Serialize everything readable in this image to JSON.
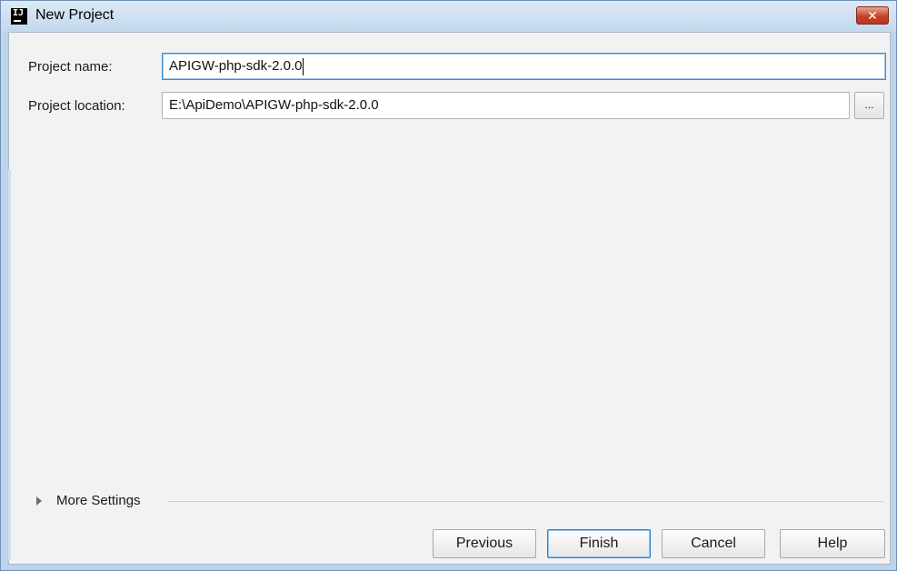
{
  "window": {
    "title": "New Project",
    "app_icon_text": "IJ"
  },
  "titlebar": {
    "close_label": "✕"
  },
  "form": {
    "project_name_label": "Project name:",
    "project_name_value": "APIGW-php-sdk-2.0.0",
    "project_location_label": "Project location:",
    "project_location_value": "E:\\ApiDemo\\APIGW-php-sdk-2.0.0",
    "browse_label": "..."
  },
  "more_settings": {
    "label": "More Settings",
    "icon": "expand-triangle-icon"
  },
  "footer": {
    "previous_label": "Previous",
    "finish_label": "Finish",
    "cancel_label": "Cancel",
    "help_label": "Help"
  },
  "colors": {
    "titlebar": "#c3d8ee",
    "close_button": "#c8412a",
    "focus_border": "#3a8fd6",
    "dialog_background": "#f2f2f2"
  }
}
